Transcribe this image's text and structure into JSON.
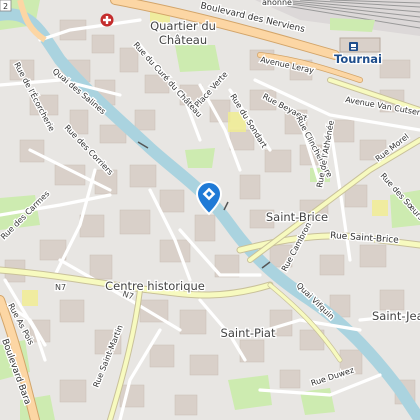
{
  "map": {
    "colors": {
      "background": "#f2efe9",
      "building": "#d9d0c9",
      "residential": "#e0dfdf",
      "park": "#cdebb0",
      "water": "#aad3df",
      "primary_road": "#fcd6a4",
      "secondary_road": "#f7fabf",
      "railway": "#999999",
      "marker": "#1f7ad6"
    },
    "labels": {
      "areas": {
        "quartier_du_chateau": [
          "Quartier du",
          "Château"
        ],
        "saint_brice": "Saint-Brice",
        "centre_historique": "Centre historique",
        "saint_piat": "Saint-Piat",
        "saint_jean": "Saint-Jean",
        "tournai_station": "Tournai"
      },
      "streets": {
        "boulevard_des_nerviens": "Boulevard des Nerviens",
        "rue_du_cure_du_chateau": "Rue du Curé du Château",
        "avenue_leray": "Avenue Leray",
        "avenue_van_cutsem": "Avenue Van Cutsem",
        "place_verte": "Place Verte",
        "rue_beyaert": "Rue Beyaert",
        "rue_du_sondart": "Rue du Sondart",
        "rue_de_l_ecorcherie": "Rue de l'Écorcherie",
        "quai_des_salines": "Quai des Salines",
        "rue_des_corriers": "Rue des Corriers",
        "rue_clinchemore": "Rue Clinchemore",
        "rue_de_l_athenee": "Rue de l'Athénée",
        "rue_morel": "Rue Morel",
        "rue_des_soeurs_de_noir": "Rue des Sœurs de Noir",
        "rue_des_carmes": "Rue des Carmes",
        "rue_cambron": "Rue Cambron",
        "rue_saint_brice": "Rue Saint-Brice",
        "quai_vifquin": "Quai Vifquin",
        "rue_as_pois": "Rue As Pois",
        "rue_saint_martin": "Rue Saint-Martin",
        "rue_duwez": "Rue Duwez",
        "boulevard_bara": "Boulevard Bara",
        "rail_top": "ahonne",
        "route_n7_west": "N7",
        "route_n7_center": "N7",
        "top_left_shield": "2"
      }
    },
    "icons": {
      "location_marker": "location-pin-icon",
      "hospital": "hospital-icon",
      "station": "train-station-icon"
    }
  }
}
